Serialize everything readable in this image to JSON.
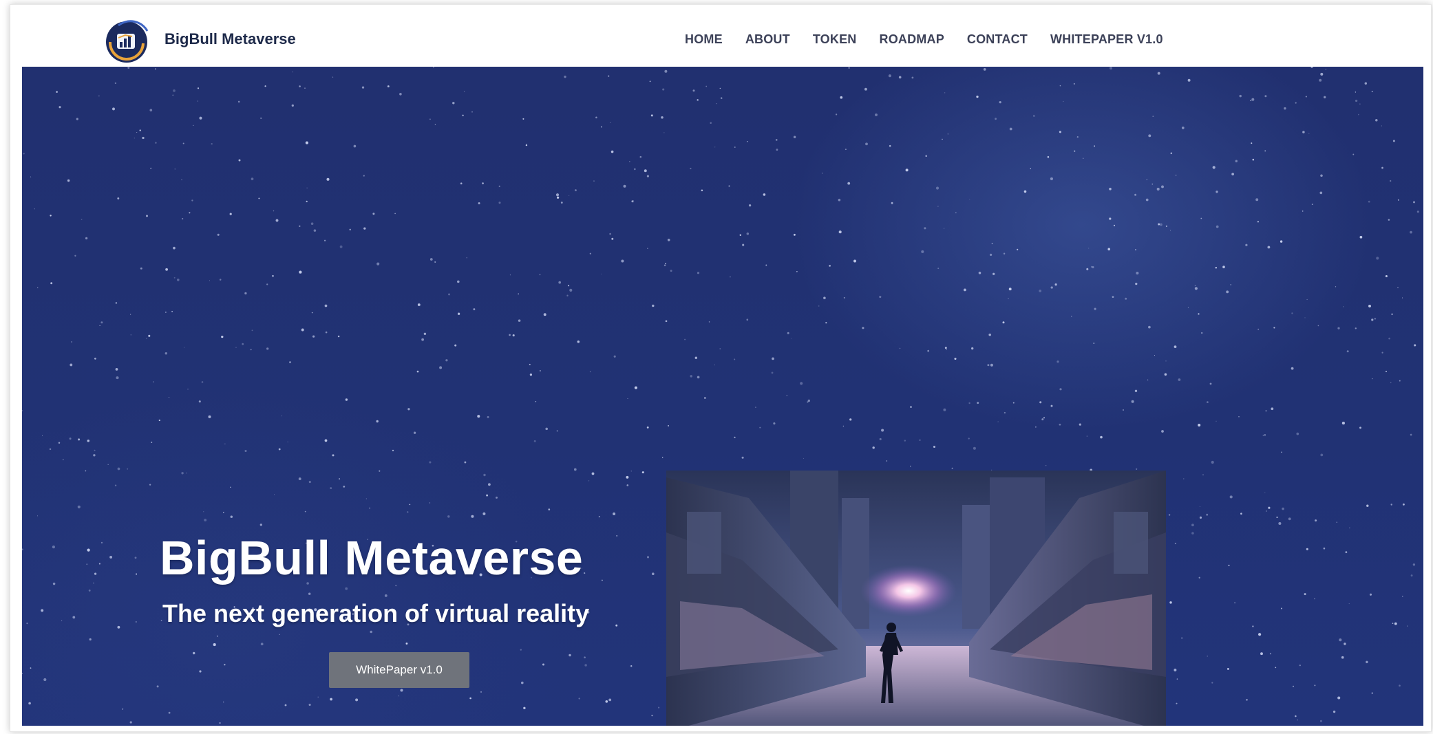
{
  "nav": {
    "brand": "BigBull Metaverse",
    "links": [
      "HOME",
      "ABOUT",
      "TOKEN",
      "ROADMAP",
      "CONTACT",
      "WHITEPAPER V1.0"
    ]
  },
  "hero": {
    "title": "BigBull Metaverse",
    "subtitle": "The next generation of virtual reality",
    "button_label": "WhitePaper v1.0"
  },
  "colors": {
    "hero_background": "#213274",
    "button_background": "#6f737b",
    "nav_text": "#3c4158"
  },
  "icons": [
    "bigbull-logo-icon"
  ]
}
